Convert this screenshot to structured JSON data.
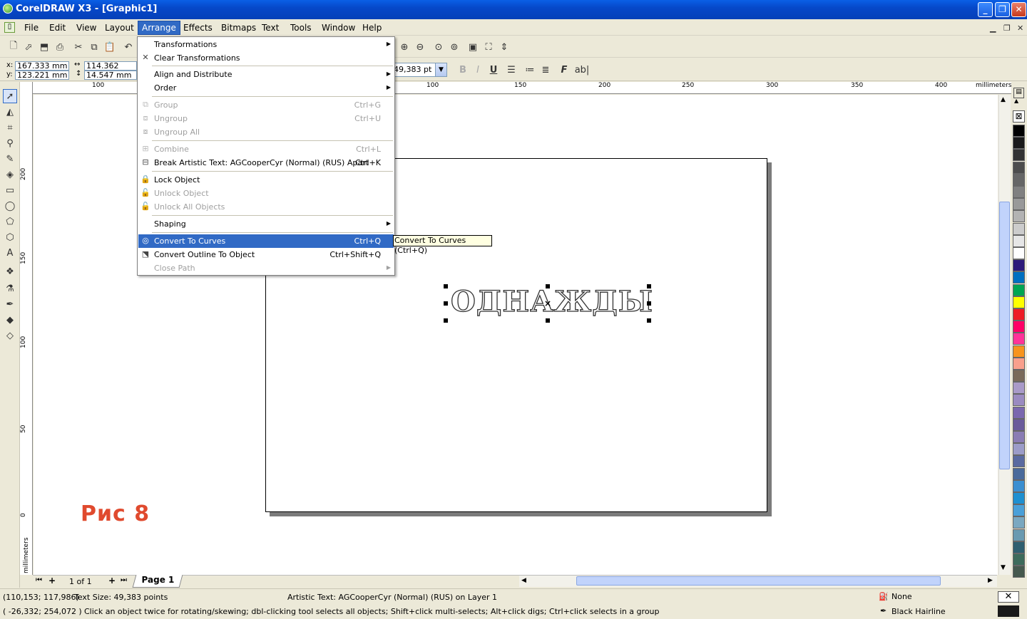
{
  "window": {
    "title": "CorelDRAW X3 - [Graphic1]"
  },
  "menubar": [
    "File",
    "Edit",
    "View",
    "Layout",
    "Arrange",
    "Effects",
    "Bitmaps",
    "Text",
    "Tools",
    "Window",
    "Help"
  ],
  "props": {
    "x": "167.333 mm",
    "y": "123.221 mm",
    "w": "114.362 mm",
    "h": "14.547 mm",
    "x_label": "x:",
    "y_label": "y:",
    "font_size": "49,383 pt"
  },
  "ruler": {
    "h_ticks": [
      "100",
      "100",
      "150",
      "200",
      "250",
      "300",
      "350",
      "400"
    ],
    "unit": "millimeters",
    "v_ticks": [
      "200",
      "150",
      "100",
      "50",
      "0"
    ]
  },
  "arrange_menu": {
    "items": [
      {
        "label": "Transformations",
        "shortcut": "",
        "submenu": true,
        "disabled": false,
        "icon": ""
      },
      {
        "label": "Clear Transformations",
        "shortcut": "",
        "submenu": false,
        "disabled": false,
        "icon": "clear-transform"
      },
      {
        "label": "Align and Distribute",
        "shortcut": "",
        "submenu": true,
        "disabled": false,
        "icon": ""
      },
      {
        "label": "Order",
        "shortcut": "",
        "submenu": true,
        "disabled": false,
        "icon": ""
      },
      {
        "label": "Group",
        "shortcut": "Ctrl+G",
        "submenu": false,
        "disabled": true,
        "icon": "group"
      },
      {
        "label": "Ungroup",
        "shortcut": "Ctrl+U",
        "submenu": false,
        "disabled": true,
        "icon": "ungroup"
      },
      {
        "label": "Ungroup All",
        "shortcut": "",
        "submenu": false,
        "disabled": true,
        "icon": "ungroup-all"
      },
      {
        "label": "Combine",
        "shortcut": "Ctrl+L",
        "submenu": false,
        "disabled": true,
        "icon": "combine"
      },
      {
        "label": "Break Artistic Text: AGCooperCyr (Normal) (RUS) Apart",
        "shortcut": "Ctrl+K",
        "submenu": false,
        "disabled": false,
        "icon": "break-apart"
      },
      {
        "label": "Lock Object",
        "shortcut": "",
        "submenu": false,
        "disabled": false,
        "icon": "lock"
      },
      {
        "label": "Unlock Object",
        "shortcut": "",
        "submenu": false,
        "disabled": true,
        "icon": "unlock"
      },
      {
        "label": "Unlock All Objects",
        "shortcut": "",
        "submenu": false,
        "disabled": true,
        "icon": "unlock-all"
      },
      {
        "label": "Shaping",
        "shortcut": "",
        "submenu": true,
        "disabled": false,
        "icon": ""
      },
      {
        "label": "Convert To Curves",
        "shortcut": "Ctrl+Q",
        "submenu": false,
        "disabled": false,
        "highlighted": true,
        "icon": "convert-curves"
      },
      {
        "label": "Convert Outline To Object",
        "shortcut": "Ctrl+Shift+Q",
        "submenu": false,
        "disabled": false,
        "icon": "outline-object"
      },
      {
        "label": "Close Path",
        "shortcut": "",
        "submenu": true,
        "disabled": true,
        "icon": ""
      }
    ]
  },
  "tooltip": "Convert To Curves (Ctrl+Q)",
  "canvas": {
    "artistic_text": "ОДНАЖДЫ",
    "caption": "Рис 8"
  },
  "nav": {
    "page_count": "1 of 1",
    "page_tab": "Page 1"
  },
  "status": {
    "coords1": "(110,153; 117,986)",
    "text_size": "Text Size: 49,383 points",
    "object_info": "Artistic Text: AGCooperCyr (Normal) (RUS) on Layer 1",
    "coords2": "( -26,332; 254,072 )",
    "hint": "Click an object twice for rotating/skewing; dbl-clicking tool selects all objects; Shift+click multi-selects; Alt+click digs; Ctrl+click selects in a group",
    "fill": "None",
    "outline": "Black  Hairline"
  },
  "palette": [
    "#000000",
    "#1a1a1a",
    "#333333",
    "#4d4d4d",
    "#666666",
    "#808080",
    "#999999",
    "#b3b3b3",
    "#cccccc",
    "#e6e6e6",
    "#ffffff",
    "#2e1a7a",
    "#0070c0",
    "#00a651",
    "#ffff00",
    "#ed1c24",
    "#ff0066",
    "#ff3399",
    "#f7941d",
    "#f9a08c",
    "#7a6a5a",
    "#a99ac8",
    "#9b8bc0",
    "#7b68ae",
    "#6b5b9a",
    "#8a7cb3",
    "#9c9cc8",
    "#5a6aa0",
    "#4a6a9a",
    "#3b8fd0",
    "#1e90d0",
    "#4aa0d8",
    "#7aa8c0",
    "#6a9ab0",
    "#2f5f6f",
    "#3d6b5b",
    "#46594e"
  ]
}
